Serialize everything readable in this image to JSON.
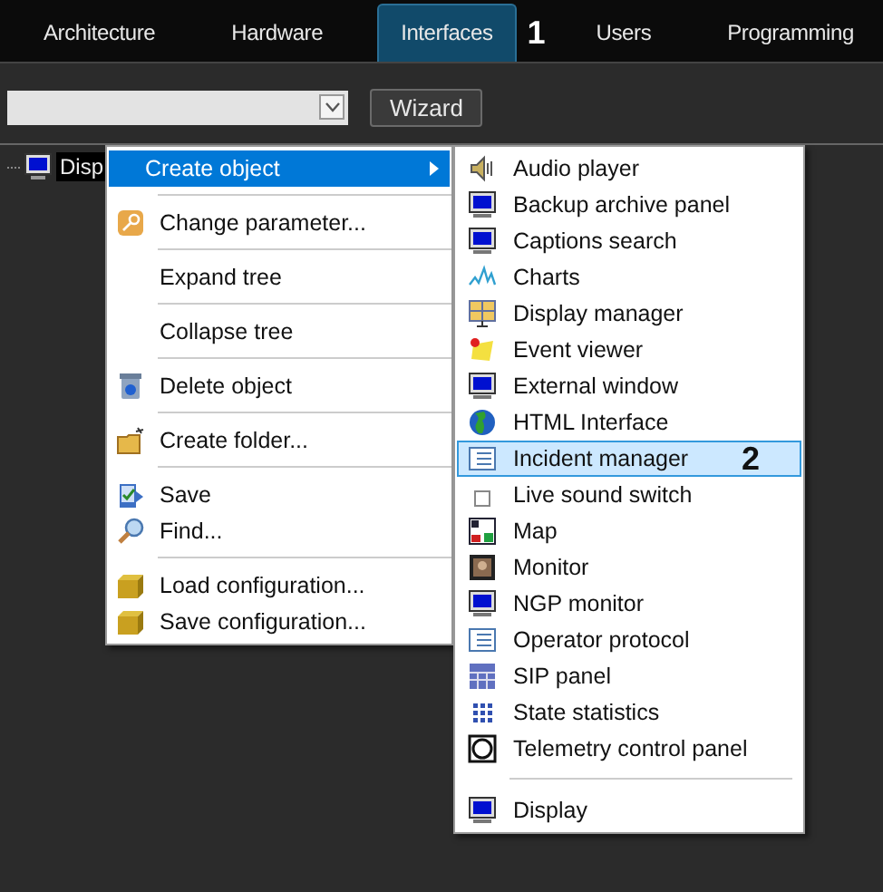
{
  "tabs": [
    {
      "label": "Architecture",
      "selected": false
    },
    {
      "label": "Hardware",
      "selected": false
    },
    {
      "label": "Interfaces",
      "selected": true
    },
    {
      "label": "Users",
      "selected": false
    },
    {
      "label": "Programming",
      "selected": false
    }
  ],
  "tab_annotation": "1",
  "toolbar": {
    "wizard_button": "Wizard"
  },
  "tree": {
    "items": [
      {
        "label": "Disp",
        "selected": true
      }
    ]
  },
  "context_menu": {
    "items": [
      {
        "kind": "item",
        "label": "Create object",
        "selected": true,
        "submenu": true
      },
      {
        "kind": "separator"
      },
      {
        "kind": "item",
        "label": "Change parameter...",
        "selected": false,
        "submenu": false
      },
      {
        "kind": "separator"
      },
      {
        "kind": "item",
        "label": "Expand tree",
        "selected": false,
        "submenu": false
      },
      {
        "kind": "separator"
      },
      {
        "kind": "item",
        "label": "Collapse tree",
        "selected": false,
        "submenu": false
      },
      {
        "kind": "separator"
      },
      {
        "kind": "item",
        "label": "Delete object",
        "selected": false,
        "submenu": false
      },
      {
        "kind": "separator"
      },
      {
        "kind": "item",
        "label": "Create folder...",
        "selected": false,
        "submenu": false
      },
      {
        "kind": "separator"
      },
      {
        "kind": "item",
        "label": "Save",
        "selected": false,
        "submenu": false
      },
      {
        "kind": "item",
        "label": "Find...",
        "selected": false,
        "submenu": false
      },
      {
        "kind": "separator"
      },
      {
        "kind": "item",
        "label": "Load configuration...",
        "selected": false,
        "submenu": false
      },
      {
        "kind": "item",
        "label": "Save configuration...",
        "selected": false,
        "submenu": false
      }
    ]
  },
  "submenu": {
    "annotation": "2",
    "items": [
      {
        "kind": "item",
        "label": "Audio player",
        "selected": false
      },
      {
        "kind": "item",
        "label": "Backup archive panel",
        "selected": false
      },
      {
        "kind": "item",
        "label": "Captions search",
        "selected": false
      },
      {
        "kind": "item",
        "label": "Charts",
        "selected": false
      },
      {
        "kind": "item",
        "label": "Display manager",
        "selected": false
      },
      {
        "kind": "item",
        "label": "Event viewer",
        "selected": false
      },
      {
        "kind": "item",
        "label": "External window",
        "selected": false
      },
      {
        "kind": "item",
        "label": "HTML Interface",
        "selected": false
      },
      {
        "kind": "item",
        "label": "Incident manager",
        "selected": true
      },
      {
        "kind": "item",
        "label": "Live sound switch",
        "selected": false
      },
      {
        "kind": "item",
        "label": "Map",
        "selected": false
      },
      {
        "kind": "item",
        "label": "Monitor",
        "selected": false
      },
      {
        "kind": "item",
        "label": "NGP monitor",
        "selected": false
      },
      {
        "kind": "item",
        "label": "Operator protocol",
        "selected": false
      },
      {
        "kind": "item",
        "label": "SIP panel",
        "selected": false
      },
      {
        "kind": "item",
        "label": "State statistics",
        "selected": false
      },
      {
        "kind": "item",
        "label": "Telemetry control panel",
        "selected": false
      },
      {
        "kind": "separator"
      },
      {
        "kind": "item",
        "label": "Display",
        "selected": false
      }
    ]
  }
}
